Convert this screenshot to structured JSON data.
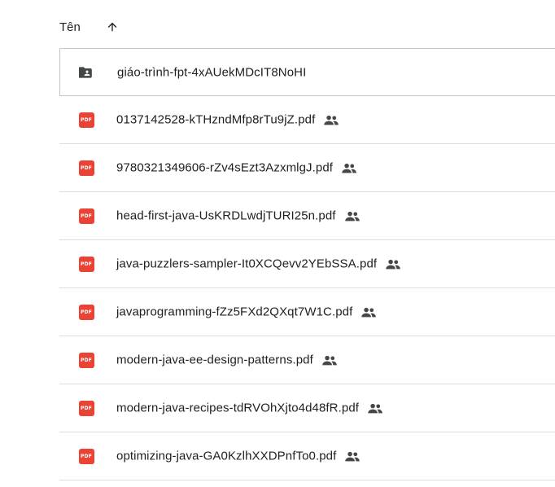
{
  "header": {
    "name_label": "Tên",
    "sort_direction": "ascending",
    "sort_icon": "arrow-up-icon"
  },
  "colors": {
    "pdf": "#ea4335",
    "folder": "#444746",
    "divider": "#dadce0",
    "text": "#1f1f1f"
  },
  "files": [
    {
      "name": "giáo-trình-fpt-4xAUekMDcIT8NoHI",
      "type": "shared-folder",
      "icon": "shared-folder-icon",
      "shared": false,
      "selected": true
    },
    {
      "name": "0137142528-kTHzndMfp8rTu9jZ.pdf",
      "type": "pdf",
      "icon": "pdf-icon",
      "badge": "PDF",
      "shared": true
    },
    {
      "name": "9780321349606-rZv4sEzt3AzxmlgJ.pdf",
      "type": "pdf",
      "icon": "pdf-icon",
      "badge": "PDF",
      "shared": true
    },
    {
      "name": "head-first-java-UsKRDLwdjTURI25n.pdf",
      "type": "pdf",
      "icon": "pdf-icon",
      "badge": "PDF",
      "shared": true
    },
    {
      "name": "java-puzzlers-sampler-It0XCQevv2YEbSSA.pdf",
      "type": "pdf",
      "icon": "pdf-icon",
      "badge": "PDF",
      "shared": true
    },
    {
      "name": "javaprogramming-fZz5FXd2QXqt7W1C.pdf",
      "type": "pdf",
      "icon": "pdf-icon",
      "badge": "PDF",
      "shared": true
    },
    {
      "name": "modern-java-ee-design-patterns.pdf",
      "type": "pdf",
      "icon": "pdf-icon",
      "badge": "PDF",
      "shared": true
    },
    {
      "name": "modern-java-recipes-tdRVOhXjto4d48fR.pdf",
      "type": "pdf",
      "icon": "pdf-icon",
      "badge": "PDF",
      "shared": true
    },
    {
      "name": "optimizing-java-GA0KzlhXXDPnfTo0.pdf",
      "type": "pdf",
      "icon": "pdf-icon",
      "badge": "PDF",
      "shared": true
    }
  ]
}
